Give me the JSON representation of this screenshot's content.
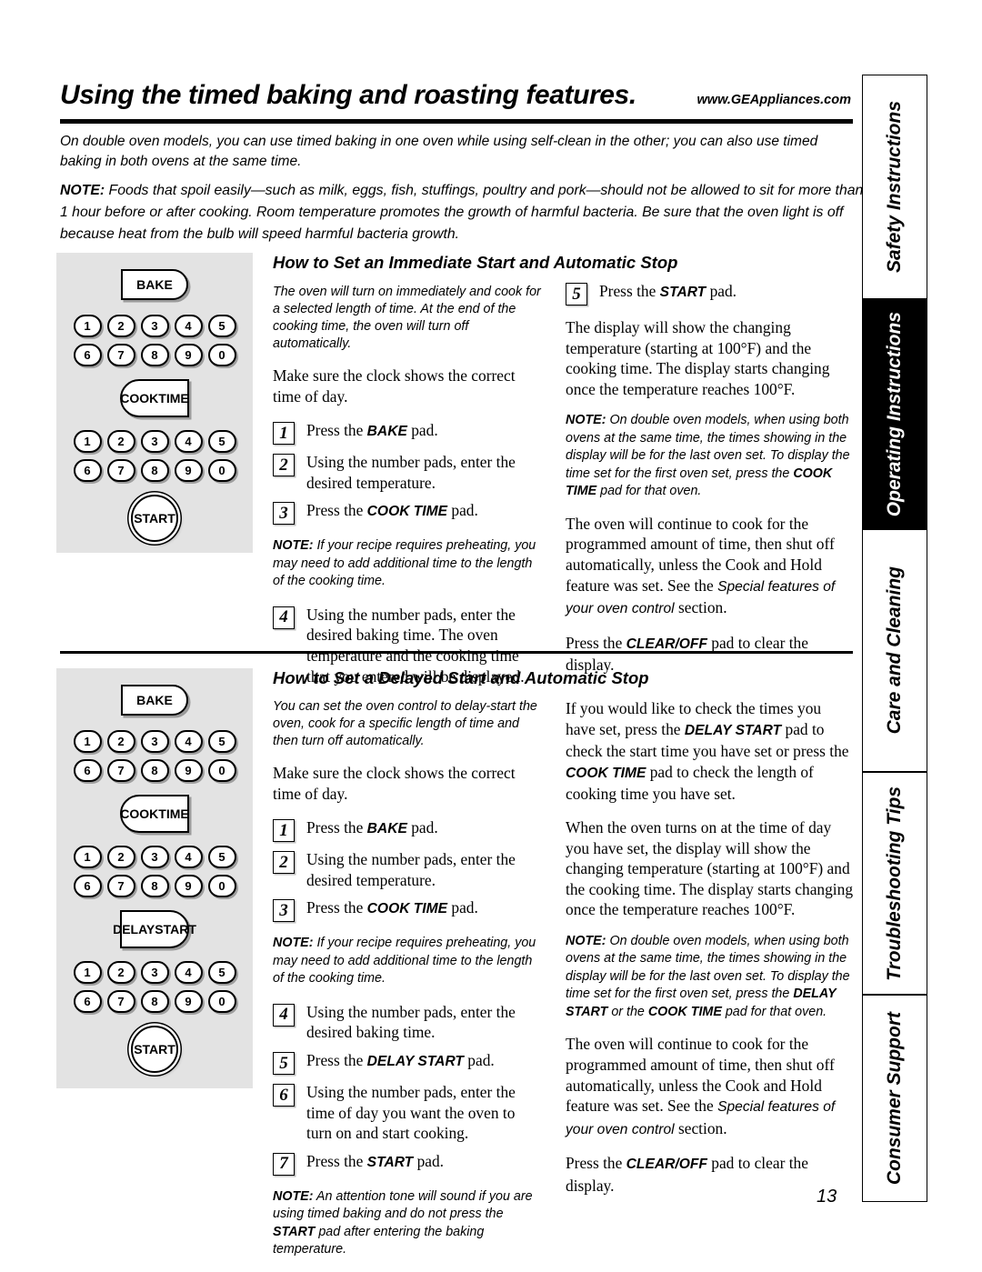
{
  "header": {
    "title": "Using the timed baking and roasting features.",
    "url": "www.GEAppliances.com"
  },
  "intro": "On double oven models, you can use timed baking in one oven while using self-clean in the other; you can also use timed baking in both ovens at the same time.",
  "top_note": {
    "label": "NOTE:",
    "text": " Foods that spoil easily—such as milk, eggs, fish, stuffings, poultry and pork—should not be allowed to sit for more than 1 hour before or after cooking. Room temperature promotes the growth of harmful bacteria. Be sure that the oven light is off because heat from the bulb will speed harmful bacteria growth."
  },
  "keypads": {
    "digits_row1": [
      "1",
      "2",
      "3",
      "4",
      "5"
    ],
    "digits_row2": [
      "6",
      "7",
      "8",
      "9",
      "0"
    ],
    "bake_label": "BAKE",
    "cook_time_label_line1": "COOK",
    "cook_time_label_line2": "TIME",
    "delay_start_label_line1": "DELAY",
    "delay_start_label_line2": "START",
    "start_label": "START"
  },
  "section1": {
    "heading": "How to Set an Immediate Start and Automatic Stop",
    "lead": "The oven will turn on immediately and cook for a selected length of time. At the end of the cooking time, the oven will turn off automatically.",
    "clock_note": "Make sure the clock shows the correct time of day.",
    "steps": [
      {
        "num": "1",
        "pre": "Press the ",
        "pad": "BAKE",
        "post": " pad."
      },
      {
        "num": "2",
        "pre": "Using the number pads, enter the desired temperature.",
        "pad": "",
        "post": ""
      },
      {
        "num": "3",
        "pre": "Press the ",
        "pad": "COOK TIME",
        "post": " pad."
      },
      {
        "num": "4",
        "pre": "Using the number pads, enter the desired baking time. The oven temperature and the cooking time that you entered will be displayed.",
        "pad": "",
        "post": ""
      },
      {
        "num": "5",
        "pre": "Press the ",
        "pad": "START",
        "post": " pad."
      }
    ],
    "preheat_note_label": "NOTE:",
    "preheat_note_text": " If your recipe requires preheating, you may need to add additional time to the length of the cooking time.",
    "display_para": "The display will show the changing temperature (starting at 100°F) and the cooking time. The display starts changing once the temperature reaches 100°F.",
    "double_oven_note_label": "NOTE:",
    "double_oven_note_a": " On double oven models, when using both ovens at the same time, the times showing in the display will be for the last oven set. To display the time set for the first oven set, press the ",
    "double_oven_note_pad": "COOK TIME",
    "double_oven_note_b": " pad for that oven.",
    "continue_pre": "The oven will continue to cook for the programmed amount of time, then shut off automatically, unless the Cook and Hold feature was set. See the ",
    "continue_italic": "Special features of your oven control",
    "continue_post": " section.",
    "clear_pre": "Press the ",
    "clear_pad": "CLEAR/OFF",
    "clear_post": " pad to clear the display."
  },
  "section2": {
    "heading": "How to Set a Delayed Start and Automatic Stop",
    "lead": "You can set the oven control to delay-start the oven, cook for a specific length of time and then turn off automatically.",
    "clock_note": "Make sure the clock shows the correct time of day.",
    "steps": [
      {
        "num": "1",
        "pre": "Press the ",
        "pad": "BAKE",
        "post": " pad."
      },
      {
        "num": "2",
        "pre": "Using the number pads, enter the desired temperature.",
        "pad": "",
        "post": ""
      },
      {
        "num": "3",
        "pre": "Press the ",
        "pad": "COOK TIME",
        "post": " pad."
      },
      {
        "num": "4",
        "pre": "Using the number pads, enter the desired baking time.",
        "pad": "",
        "post": ""
      },
      {
        "num": "5",
        "pre": "Press the ",
        "pad": "DELAY START",
        "post": " pad."
      },
      {
        "num": "6",
        "pre": "Using the number pads, enter the time of day you want the oven to turn on and start cooking.",
        "pad": "",
        "post": ""
      },
      {
        "num": "7",
        "pre": "Press the ",
        "pad": "START",
        "post": " pad."
      }
    ],
    "preheat_note_label": "NOTE:",
    "preheat_note_text": " If your recipe requires preheating, you may need to add additional time to the length of the cooking time.",
    "attention_note_label": "NOTE:",
    "attention_note_a": " An attention tone will sound if you are using timed baking and do not press the ",
    "attention_note_pad": "START",
    "attention_note_b": " pad after entering the baking temperature.",
    "check_pre": "If you would like to check the times you have set, press the ",
    "check_pad1": "DELAY START",
    "check_mid": " pad to check the start time you have set or press the ",
    "check_pad2": "COOK TIME",
    "check_post": " pad to check the length of cooking time you have set.",
    "turns_on_para": "When the oven turns on at the time of day you have set, the display will show the changing temperature (starting at 100°F) and the cooking time. The display starts changing once the temperature reaches 100°F.",
    "double_oven_note_label": "NOTE:",
    "double_oven_note_a": " On double oven models, when using both ovens at the same time, the times showing in the display will be for the last oven set. To display the time set for the first oven set, press the ",
    "double_oven_note_pad1": "DELAY START",
    "double_oven_note_mid": " or the ",
    "double_oven_note_pad2": "COOK TIME",
    "double_oven_note_b": " pad for that oven.",
    "continue_pre": "The oven will continue to cook for the programmed amount of time, then shut off automatically, unless the Cook and Hold feature was set. See the ",
    "continue_italic": "Special features of your oven control",
    "continue_post": " section.",
    "clear_pre": "Press the ",
    "clear_pad": "CLEAR/OFF",
    "clear_post": " pad to clear the display."
  },
  "sidebar": {
    "tabs": [
      {
        "label": "Safety Instructions",
        "active": false
      },
      {
        "label": "Operating Instructions",
        "active": true
      },
      {
        "label": "Care and Cleaning",
        "active": false
      },
      {
        "label": "Troubleshooting Tips",
        "active": false
      },
      {
        "label": "Consumer Support",
        "active": false
      }
    ]
  },
  "page_number": "13"
}
